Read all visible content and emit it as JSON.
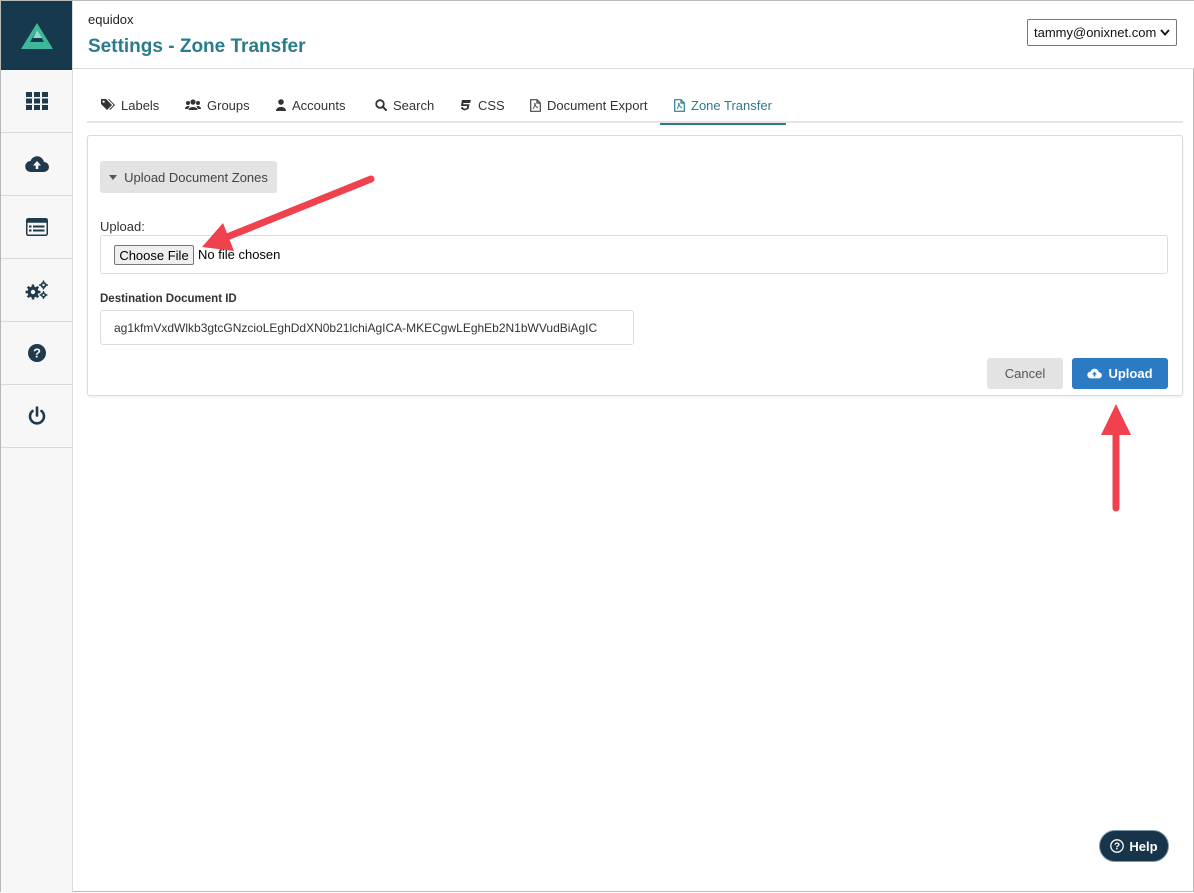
{
  "header": {
    "brand": "equidox",
    "title": "Settings - Zone Transfer",
    "user": "tammy@onixnet.com"
  },
  "sidebar": {
    "items": [
      {
        "icon": "grid-icon",
        "label": "Dashboard"
      },
      {
        "icon": "cloud-upload-icon",
        "label": "Upload"
      },
      {
        "icon": "list-icon",
        "label": "Documents"
      },
      {
        "icon": "gears-icon",
        "label": "Settings"
      },
      {
        "icon": "question-icon",
        "label": "Help"
      },
      {
        "icon": "power-icon",
        "label": "Logout"
      }
    ]
  },
  "tabs": [
    {
      "label": "Labels",
      "icon": "tag-icon"
    },
    {
      "label": "Groups",
      "icon": "users-icon"
    },
    {
      "label": "Accounts",
      "icon": "user-icon"
    },
    {
      "label": "Search",
      "icon": "search-icon"
    },
    {
      "label": "CSS",
      "icon": "css-icon"
    },
    {
      "label": "Document Export",
      "icon": "pdf-icon"
    },
    {
      "label": "Zone Transfer",
      "icon": "pdf-icon",
      "active": true
    }
  ],
  "panel": {
    "toggle_label": "Upload Document Zones",
    "upload_label": "Upload:",
    "choose_file": "Choose File",
    "no_file": "No file chosen",
    "dest_label": "Destination Document ID",
    "dest_value": "ag1kfmVxdWlkb3gtcGNzcioLEghDdXN0b21lchiAgICA-MKECgwLEghEb2N1bWVudBiAgIC",
    "cancel": "Cancel",
    "upload": "Upload"
  },
  "help": {
    "label": "Help"
  },
  "colors": {
    "accent": "#2a7c8c",
    "primary": "#2b7bc4",
    "sidebar_logo_bg": "#16394d",
    "annotation": "#f0414f"
  }
}
